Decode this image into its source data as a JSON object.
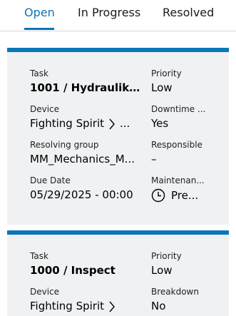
{
  "tabs": [
    {
      "label": "Open",
      "active": true
    },
    {
      "label": "In Progress",
      "active": false
    },
    {
      "label": "Resolved",
      "active": false
    }
  ],
  "colors": {
    "accent": "#0a77b9",
    "card_bg": "#eff1f2"
  },
  "cards": [
    {
      "task_label": "Task",
      "task_value": "1001 / Hydraulika...",
      "priority_label": "Priority",
      "priority_value": "Low",
      "device_label": "Device",
      "device_value": "Fighting Spirit",
      "device_more": "...",
      "downtime_label": "Downtime ...",
      "downtime_value": "Yes",
      "group_label": "Resolving group",
      "group_value": "MM_Mechanics_M...",
      "responsible_label": "Responsible",
      "responsible_value": "–",
      "due_label": "Due Date",
      "due_value": "05/29/2025 - 00:00",
      "maint_label": "Maintenan...",
      "maint_value": "Pre...",
      "maint_icon": "clock-icon"
    },
    {
      "task_label": "Task",
      "task_value": "1000 / Inspect",
      "priority_label": "Priority",
      "priority_value": "Low",
      "device_label": "Device",
      "device_value": "Fighting Spirit",
      "breakdown_label": "Breakdown",
      "breakdown_value": "No"
    }
  ]
}
